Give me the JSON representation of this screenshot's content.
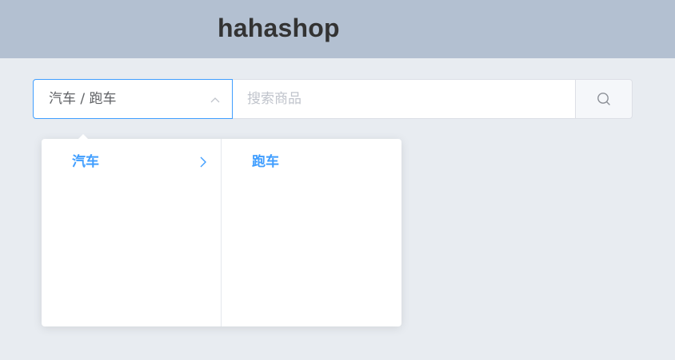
{
  "header": {
    "title": "hahashop"
  },
  "search": {
    "category_value": "汽车 / 跑车",
    "placeholder": "搜索商品",
    "value": ""
  },
  "cascader_menu": {
    "level1": [
      {
        "label": "汽车",
        "active": true,
        "has_children": true
      }
    ],
    "level2": [
      {
        "label": "跑车",
        "active": true,
        "has_children": false
      }
    ]
  },
  "colors": {
    "header_bg": "#b3c0d1",
    "page_bg": "#e8ecf1",
    "accent": "#409eff",
    "placeholder": "#c0c4cc"
  },
  "icons": {
    "cascader_arrow": "chevron-up-icon",
    "search_button": "search-icon",
    "menu_expand": "chevron-right-icon"
  }
}
